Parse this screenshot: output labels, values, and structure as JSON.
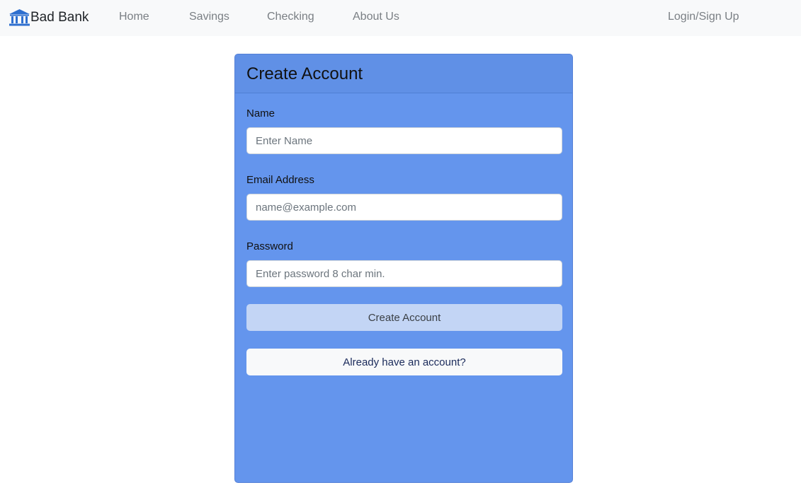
{
  "navbar": {
    "brand_icon": "bank-icon",
    "brand": "Bad Bank",
    "links": [
      {
        "label": "Home"
      },
      {
        "label": "Savings"
      },
      {
        "label": "Checking"
      },
      {
        "label": "About Us"
      }
    ],
    "login_label": "Login/Sign Up"
  },
  "card": {
    "title": "Create Account",
    "fields": {
      "name": {
        "label": "Name",
        "placeholder": "Enter Name",
        "value": ""
      },
      "email": {
        "label": "Email Address",
        "placeholder": "name@example.com",
        "value": ""
      },
      "password": {
        "label": "Password",
        "placeholder": "Enter password 8 char min.",
        "value": ""
      }
    },
    "create_button": "Create Account",
    "login_button": "Already have an account?"
  },
  "colors": {
    "card_background": "#6495ed",
    "navbar_background": "#f8f9fa",
    "create_button_background": "#c3d5f5",
    "brand_icon_color": "#2e6fcf"
  }
}
